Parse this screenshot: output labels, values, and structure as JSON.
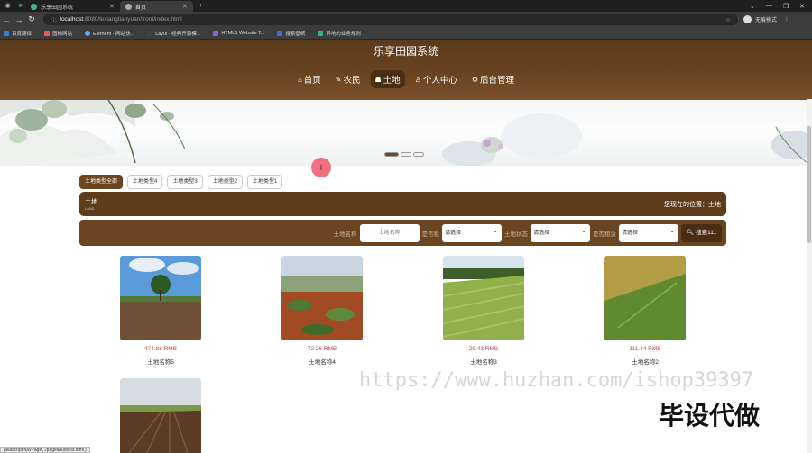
{
  "browser": {
    "tabs": [
      {
        "title": "乐享田园系统",
        "active": false
      },
      {
        "title": "首页",
        "active": true
      }
    ],
    "url_host": "localhost",
    "url_path": ":8080/lexiangtianyuan/front/index.html",
    "profile": "无痕模式",
    "bookmarks": [
      "百度翻译",
      "图标网站",
      "Element - 网站快...",
      "Layui - 经典开源模...",
      "HTML5 Website T...",
      "搜索壁纸",
      "异地的业务规则"
    ]
  },
  "site": {
    "title": "乐享田园系统",
    "menu": [
      {
        "icon": "⌂",
        "label": "首页"
      },
      {
        "icon": "✎",
        "label": "农民"
      },
      {
        "icon": "☗",
        "label": "土地"
      },
      {
        "icon": "♙",
        "label": "个人中心"
      },
      {
        "icon": "⚙",
        "label": "后台管理"
      }
    ]
  },
  "cursor_marker": "I",
  "categories": [
    "土地类型全部",
    "土地类型4",
    "土地类型3",
    "土地类型2",
    "土地类型1"
  ],
  "crumb": {
    "section": "土地",
    "sub": "LAND",
    "location": "您现在的位置：土地"
  },
  "filter": {
    "name_label": "土地名称",
    "name_placeholder": "土地名称",
    "l2": "是否租",
    "l3": "土地状态",
    "l4": "是否租赁",
    "select_default": "请选择",
    "search_btn": "搜索111"
  },
  "cards": [
    {
      "price": "474.88 RMB",
      "name": "土地名称5"
    },
    {
      "price": "72.26 RMB",
      "name": "土地名称4"
    },
    {
      "price": "29.43 RMB",
      "name": "土地名称3"
    },
    {
      "price": "111.44 RMB",
      "name": "土地名称2"
    }
  ],
  "status_bar": "javascript:navPage('./pages/tudi/list.html')",
  "watermark": "https://www.huzhan.com/ishop39397",
  "watermark2": "毕设代做",
  "colors": {
    "brand": "#6b4520",
    "price": "#d04040"
  }
}
